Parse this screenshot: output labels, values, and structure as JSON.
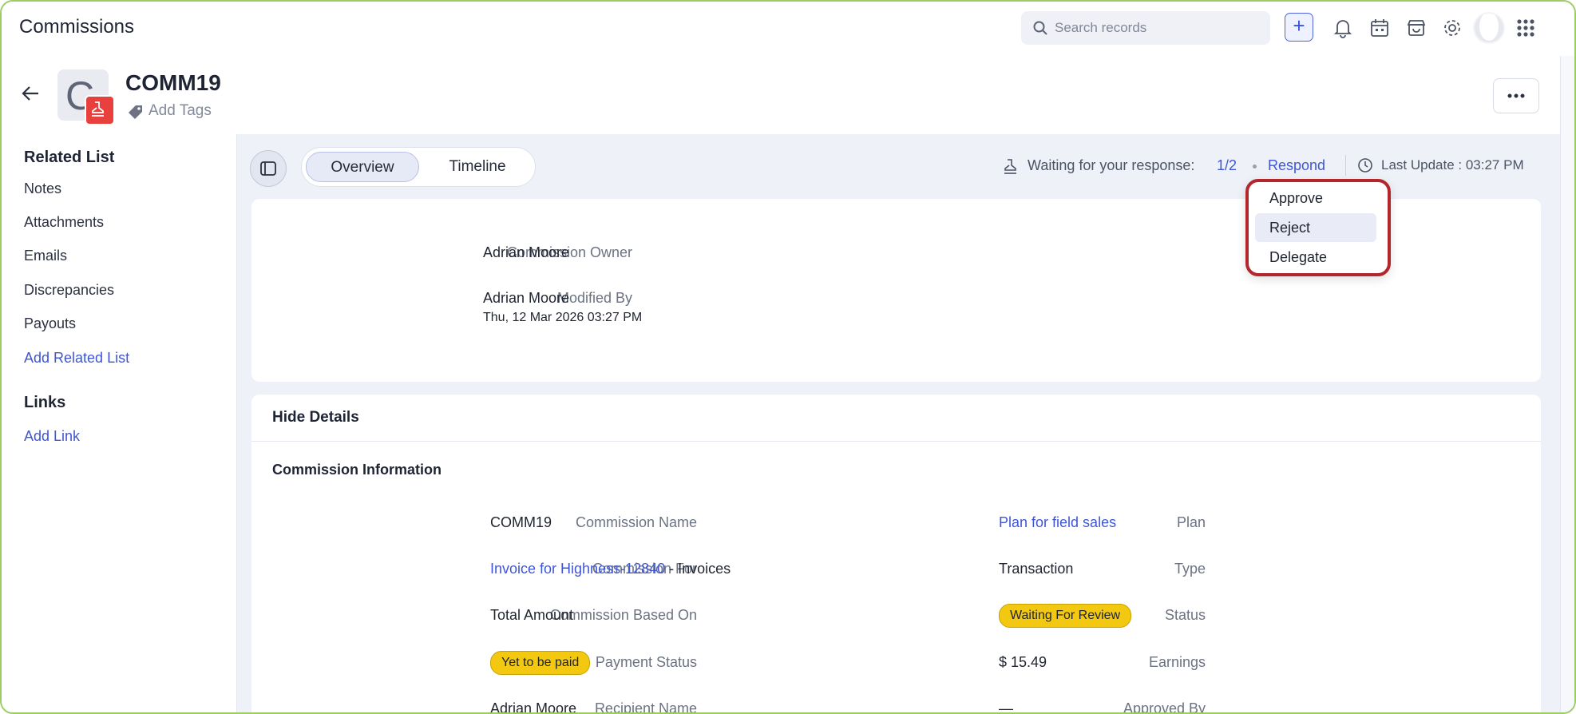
{
  "app": {
    "title": "Commissions"
  },
  "topbar": {
    "search_placeholder": "Search records",
    "add_label": "+"
  },
  "record": {
    "name": "COMM19",
    "avatar_letter": "C",
    "add_tags": "Add Tags"
  },
  "sidebar": {
    "related_heading": "Related List",
    "items": [
      "Notes",
      "Attachments",
      "Emails",
      "Discrepancies",
      "Payouts"
    ],
    "add_related": "Add Related List",
    "links_heading": "Links",
    "add_link": "Add Link"
  },
  "tabs": [
    {
      "label": "Overview",
      "active": true
    },
    {
      "label": "Timeline",
      "active": false
    }
  ],
  "approval": {
    "waiting_text": "Waiting for your response:",
    "fraction": "1/2",
    "respond": "Respond",
    "last_update": "Last Update : 03:27 PM"
  },
  "respond_menu": {
    "items": [
      "Approve",
      "Reject",
      "Delegate"
    ],
    "hovered": "Reject"
  },
  "summary": {
    "owner_label": "Commission Owner",
    "owner_value": "Adrian Moore",
    "modified_label": "Modified By",
    "modified_value": "Adrian Moore",
    "modified_time": "Thu, 12 Mar 2026 03:27 PM"
  },
  "details": {
    "toggle": "Hide Details",
    "section_title": "Commission Information",
    "left": [
      {
        "label": "Commission Name",
        "value": "COMM19"
      },
      {
        "label": "Commission For",
        "value": "Invoice for Highness-12840",
        "suffix": " - Invoices"
      },
      {
        "label": "Commission Based On",
        "value": "Total Amount"
      },
      {
        "label": "Payment Status",
        "value": "Yet to be paid"
      },
      {
        "label": "Recipient Name",
        "value": "Adrian Moore"
      }
    ],
    "right": [
      {
        "label": "Plan",
        "value": "Plan for field sales"
      },
      {
        "label": "Type",
        "value": "Transaction"
      },
      {
        "label": "Status",
        "value": "Waiting For Review"
      },
      {
        "label": "Earnings",
        "value": "$ 15.49"
      },
      {
        "label": "Approved By",
        "value": "—"
      }
    ]
  },
  "colors": {
    "accent": "#3e56d6",
    "badge": "#f2c811",
    "highlight": "#b3262c",
    "frame": "#9ccc65"
  }
}
